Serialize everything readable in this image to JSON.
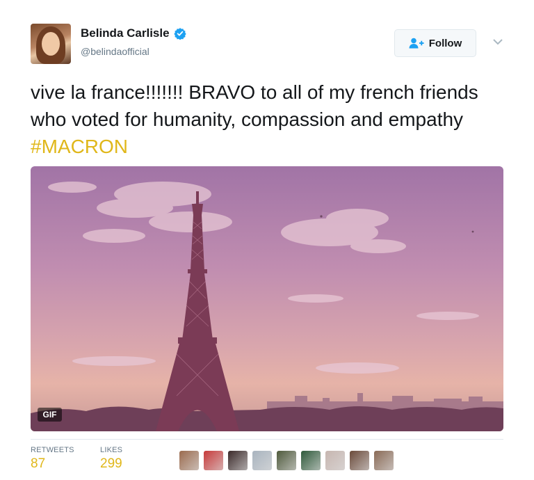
{
  "user": {
    "name": "Belinda Carlisle",
    "handle": "@belindaofficial",
    "verified": true
  },
  "follow_button": {
    "label": "Follow",
    "icon": "add-user-icon"
  },
  "tweet": {
    "text": "vive la france!!!!!!!   BRAVO to all of my french friends who voted for humanity, compassion and empathy ",
    "hashtag": "#MACRON"
  },
  "media": {
    "type": "gif",
    "badge": "GIF",
    "subject": "Eiffel Tower at sunset"
  },
  "stats": {
    "retweets_label": "RETWEETS",
    "retweets": "87",
    "likes_label": "LIKES",
    "likes": "299"
  },
  "likers": [
    {
      "color": "#9b6b4e"
    },
    {
      "color": "#c73a3a"
    },
    {
      "color": "#3b2a2a"
    },
    {
      "color": "#a9b4bf"
    },
    {
      "color": "#4f5a3c"
    },
    {
      "color": "#2e5a3a"
    },
    {
      "color": "#c7b6b0"
    },
    {
      "color": "#6b4a3a"
    },
    {
      "color": "#8a6a56"
    }
  ],
  "colors": {
    "accent": "#e0b71a",
    "verified": "#1da1f2",
    "muted": "#657786"
  }
}
